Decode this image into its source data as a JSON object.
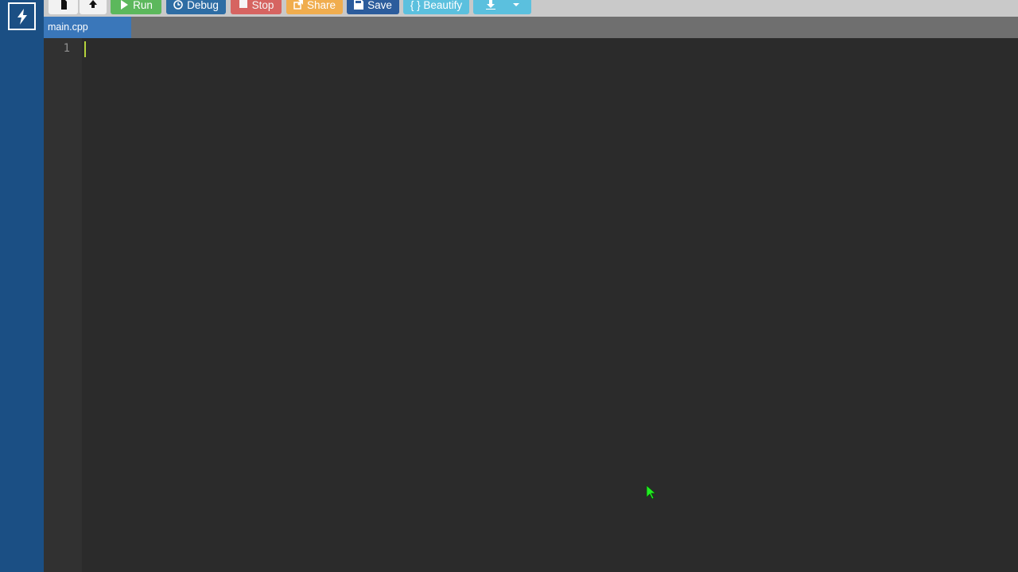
{
  "toolbar": {
    "buttons": [
      {
        "id": "new",
        "icon": "file-icon"
      },
      {
        "id": "upload",
        "icon": "upload-icon"
      },
      {
        "id": "run",
        "label": "Run",
        "icon": "play-icon",
        "color": "#5cb85c"
      },
      {
        "id": "debug",
        "label": "Debug",
        "icon": "clock-icon",
        "color": "#2e6da4"
      },
      {
        "id": "stop",
        "label": "Stop",
        "icon": "stop-icon",
        "color": "#d9534f"
      },
      {
        "id": "share",
        "label": "Share",
        "icon": "share-icon",
        "color": "#f0ad4e"
      },
      {
        "id": "save",
        "label": "Save",
        "icon": "floppy-icon",
        "color": "#2c5c9c"
      },
      {
        "id": "beautify",
        "label": "{ } Beautify",
        "color": "#5bc0de"
      },
      {
        "id": "download",
        "icon": "download-icon",
        "dropdown_icon": "caret-down-icon",
        "color": "#5bc0de"
      }
    ]
  },
  "tabs": [
    {
      "label": "main.cpp",
      "active": true
    }
  ],
  "editor": {
    "line_numbers": [
      "1"
    ],
    "caret_color": "#b5d33c"
  },
  "sidebar": {
    "logo_icon": "bolt-icon",
    "color": "#1b4f84"
  }
}
